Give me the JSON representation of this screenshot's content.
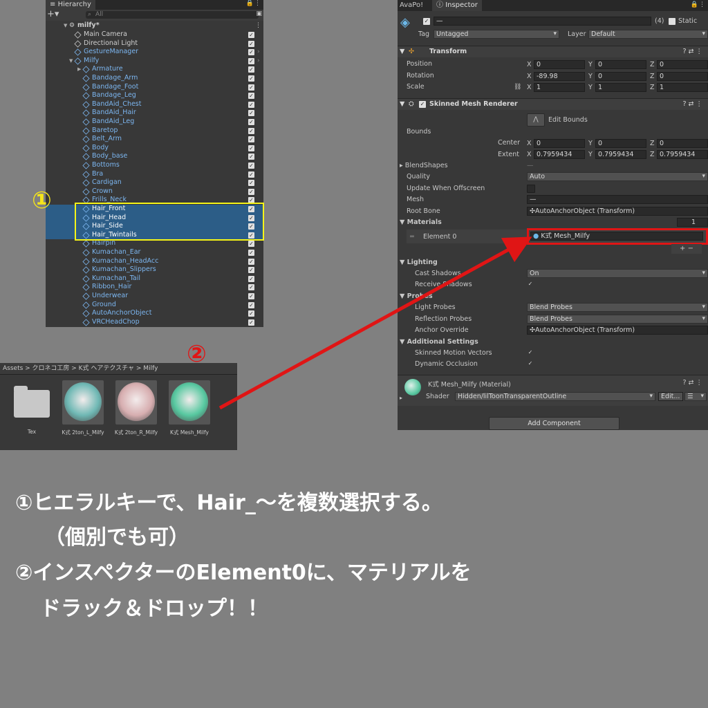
{
  "hierarchy": {
    "tab": "Hierarchy",
    "search_placeholder": "All",
    "scene": "milfy*",
    "items": [
      {
        "label": "Main Camera",
        "indent": 0,
        "prefab": false,
        "sel": false
      },
      {
        "label": "Directional Light",
        "indent": 0,
        "prefab": false,
        "sel": false
      },
      {
        "label": "GestureManager",
        "indent": 0,
        "prefab": true,
        "sel": false
      },
      {
        "label": "Milfy",
        "indent": 0,
        "prefab": true,
        "sel": false
      },
      {
        "label": "Armature",
        "indent": 1,
        "prefab": true,
        "sel": false
      },
      {
        "label": "Bandage_Arm",
        "indent": 1,
        "prefab": true,
        "sel": false
      },
      {
        "label": "Bandage_Foot",
        "indent": 1,
        "prefab": true,
        "sel": false
      },
      {
        "label": "Bandage_Leg",
        "indent": 1,
        "prefab": true,
        "sel": false
      },
      {
        "label": "BandAid_Chest",
        "indent": 1,
        "prefab": true,
        "sel": false
      },
      {
        "label": "BandAid_Hair",
        "indent": 1,
        "prefab": true,
        "sel": false
      },
      {
        "label": "BandAid_Leg",
        "indent": 1,
        "prefab": true,
        "sel": false
      },
      {
        "label": "Baretop",
        "indent": 1,
        "prefab": true,
        "sel": false
      },
      {
        "label": "Belt_Arm",
        "indent": 1,
        "prefab": true,
        "sel": false
      },
      {
        "label": "Body",
        "indent": 1,
        "prefab": true,
        "sel": false
      },
      {
        "label": "Body_base",
        "indent": 1,
        "prefab": true,
        "sel": false
      },
      {
        "label": "Bottoms",
        "indent": 1,
        "prefab": true,
        "sel": false
      },
      {
        "label": "Bra",
        "indent": 1,
        "prefab": true,
        "sel": false
      },
      {
        "label": "Cardigan",
        "indent": 1,
        "prefab": true,
        "sel": false
      },
      {
        "label": "Crown",
        "indent": 1,
        "prefab": true,
        "sel": false
      },
      {
        "label": "Frills_Neck",
        "indent": 1,
        "prefab": true,
        "sel": false
      },
      {
        "label": "Hair_Front",
        "indent": 1,
        "prefab": true,
        "sel": true
      },
      {
        "label": "Hair_Head",
        "indent": 1,
        "prefab": true,
        "sel": true
      },
      {
        "label": "Hair_Side",
        "indent": 1,
        "prefab": true,
        "sel": true
      },
      {
        "label": "Hair_Twintails",
        "indent": 1,
        "prefab": true,
        "sel": true
      },
      {
        "label": "Hairpin",
        "indent": 1,
        "prefab": true,
        "sel": false
      },
      {
        "label": "Kumachan_Ear",
        "indent": 1,
        "prefab": true,
        "sel": false
      },
      {
        "label": "Kumachan_HeadAcc",
        "indent": 1,
        "prefab": true,
        "sel": false
      },
      {
        "label": "Kumachan_Slippers",
        "indent": 1,
        "prefab": true,
        "sel": false
      },
      {
        "label": "Kumachan_Tail",
        "indent": 1,
        "prefab": true,
        "sel": false
      },
      {
        "label": "Ribbon_Hair",
        "indent": 1,
        "prefab": true,
        "sel": false
      },
      {
        "label": "Underwear",
        "indent": 1,
        "prefab": true,
        "sel": false
      },
      {
        "label": "Ground",
        "indent": 1,
        "prefab": true,
        "sel": false
      },
      {
        "label": "AutoAnchorObject",
        "indent": 1,
        "prefab": true,
        "sel": false
      },
      {
        "label": "VRCHeadChop",
        "indent": 1,
        "prefab": true,
        "sel": false
      }
    ]
  },
  "assets": {
    "breadcrumb": "Assets  >  クロネコ工房  >  K式  ヘアテクスチャ  >  Milfy",
    "items": [
      {
        "label": "Tex",
        "type": "folder"
      },
      {
        "label": "K式 2ton_L_Milfy",
        "type": "material",
        "color": "#6fb8b4"
      },
      {
        "label": "K式 2ton_R_Milfy",
        "type": "material",
        "color": "#d7aeb0"
      },
      {
        "label": "K式 Mesh_Milfy",
        "type": "material",
        "color": "#57c8a0"
      }
    ]
  },
  "inspector": {
    "tabs": [
      "AvaPo!",
      "Inspector"
    ],
    "name_value": "—",
    "count": "(4)",
    "static_label": "Static",
    "tag_label": "Tag",
    "tag_value": "Untagged",
    "layer_label": "Layer",
    "layer_value": "Default",
    "transform": {
      "title": "Transform",
      "position_label": "Position",
      "position": [
        "0",
        "0",
        "0"
      ],
      "rotation_label": "Rotation",
      "rotation": [
        "-89.98",
        "0",
        "0"
      ],
      "scale_label": "Scale",
      "scale": [
        "1",
        "1",
        "1"
      ]
    },
    "smr": {
      "title": "Skinned Mesh Renderer",
      "edit_bounds": "Edit Bounds",
      "bounds_label": "Bounds",
      "center_label": "Center",
      "center": [
        "0",
        "0",
        "0"
      ],
      "extent_label": "Extent",
      "extent": [
        "0.7959434",
        "0.7959434",
        "0.7959434"
      ],
      "blendshapes_label": "BlendShapes",
      "blendshapes_value": "—",
      "quality_label": "Quality",
      "quality_value": "Auto",
      "update_offscreen_label": "Update When Offscreen",
      "mesh_label": "Mesh",
      "mesh_value": "—",
      "rootbone_label": "Root Bone",
      "rootbone_value": "AutoAnchorObject (Transform)",
      "materials_label": "Materials",
      "materials_count": "1",
      "element0_label": "Element 0",
      "element0_value": "K式 Mesh_Milfy",
      "lighting_label": "Lighting",
      "cast_shadows_label": "Cast Shadows",
      "cast_shadows_value": "On",
      "receive_shadows_label": "Receive Shadows",
      "probes_label": "Probes",
      "light_probes_label": "Light Probes",
      "light_probes_value": "Blend Probes",
      "reflection_probes_label": "Reflection Probes",
      "reflection_probes_value": "Blend Probes",
      "anchor_override_label": "Anchor Override",
      "anchor_override_value": "AutoAnchorObject (Transform)",
      "additional_label": "Additional Settings",
      "skinned_motion_label": "Skinned Motion Vectors",
      "dynamic_occlusion_label": "Dynamic Occlusion"
    },
    "material": {
      "title": "K式 Mesh_Milfy (Material)",
      "shader_label": "Shader",
      "shader_value": "Hidden/lilToonTransparentOutline",
      "edit_label": "Edit..."
    },
    "add_component": "Add Component"
  },
  "annotations": {
    "mark1": "①",
    "mark2": "②",
    "line1": "①ヒエラルキーで、Hair_〜を複数選択する。",
    "line2": "（個別でも可）",
    "line3": "②インスペクターのElement0に、マテリアルを",
    "line4": "ドラック＆ドロップ！！",
    "mark_color": "#f5e51a",
    "arrow_color": "#e01515"
  }
}
